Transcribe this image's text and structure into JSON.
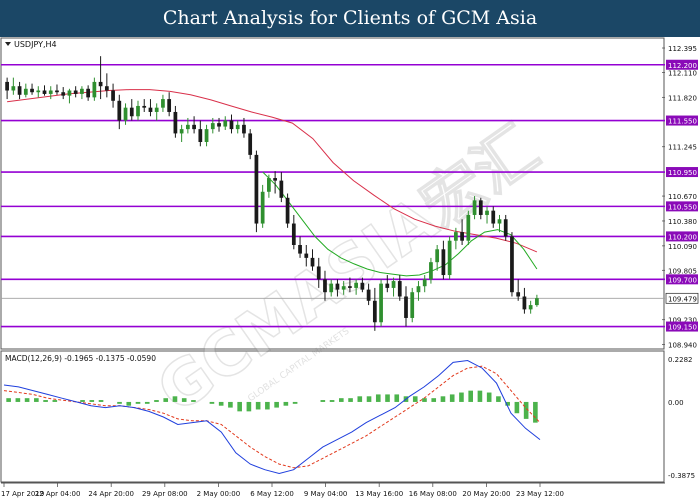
{
  "banner": {
    "title": "Chart Analysis for Clients of GCM Asia"
  },
  "watermark": {
    "text": "GCMASIA宏汇",
    "subtext": "GLOBAL CAPITAL MARKETS"
  },
  "colors": {
    "banner_bg": "#1b4766",
    "level_line": "#9400d3",
    "level_label_bg": "#8a0ab8",
    "bull_candle": "#2f8f2f",
    "bear_candle": "#1a1a1a",
    "ma_slow": "#d9304a",
    "ma_fast": "#22aa22",
    "macd_line": "#1f3fdd",
    "signal_line": "#e23a1e",
    "histogram": "#4cb34c",
    "current_price_line": "#a0a0a0"
  },
  "chart_data": [
    {
      "type": "candlestick",
      "title": "USDJPY,H4",
      "symbol_dropdown_icon": "triangle-down-icon",
      "x_tick_labels": [
        "17 Apr 2019",
        "22 Apr 04:00",
        "24 Apr 20:00",
        "29 Apr 08:00",
        "2 May 00:00",
        "6 May 12:00",
        "9 May 04:00",
        "13 May 16:00",
        "16 May 08:00",
        "20 May 20:00",
        "23 May 12:00"
      ],
      "y_tick_labels": [
        "112.395",
        "112.110",
        "111.820",
        "111.245",
        "110.670",
        "110.380",
        "110.090",
        "109.805",
        "109.230",
        "108.940"
      ],
      "ylim": [
        108.9,
        112.5
      ],
      "current_price": 109.479,
      "current_price_label": "109.479",
      "levels": [
        {
          "value": 112.2,
          "label": "112.200"
        },
        {
          "value": 111.55,
          "label": "111.550"
        },
        {
          "value": 110.95,
          "label": "110.950"
        },
        {
          "value": 110.55,
          "label": "110.550"
        },
        {
          "value": 110.2,
          "label": "110.200"
        },
        {
          "value": 109.7,
          "label": "109.700"
        },
        {
          "value": 109.15,
          "label": "109.150"
        }
      ],
      "candles": [
        [
          112.0,
          112.05,
          111.8,
          111.9
        ],
        [
          111.9,
          112.05,
          111.85,
          111.95
        ],
        [
          111.95,
          112.0,
          111.8,
          111.85
        ],
        [
          111.85,
          111.98,
          111.82,
          111.92
        ],
        [
          111.92,
          111.98,
          111.85,
          111.88
        ],
        [
          111.88,
          111.95,
          111.82,
          111.9
        ],
        [
          111.9,
          111.96,
          111.84,
          111.86
        ],
        [
          111.86,
          111.95,
          111.8,
          111.9
        ],
        [
          111.9,
          111.97,
          111.85,
          111.88
        ],
        [
          111.88,
          111.94,
          111.8,
          111.84
        ],
        [
          111.84,
          111.92,
          111.75,
          111.9
        ],
        [
          111.9,
          111.95,
          111.82,
          111.86
        ],
        [
          111.86,
          111.95,
          111.8,
          111.92
        ],
        [
          111.92,
          111.96,
          111.78,
          111.82
        ],
        [
          111.82,
          112.05,
          111.78,
          112.0
        ],
        [
          112.0,
          112.3,
          111.8,
          111.95
        ],
        [
          111.95,
          112.1,
          111.82,
          111.9
        ],
        [
          111.9,
          111.98,
          111.7,
          111.78
        ],
        [
          111.78,
          111.85,
          111.45,
          111.55
        ],
        [
          111.55,
          111.75,
          111.5,
          111.7
        ],
        [
          111.7,
          111.8,
          111.55,
          111.6
        ],
        [
          111.6,
          111.78,
          111.55,
          111.72
        ],
        [
          111.72,
          111.8,
          111.65,
          111.7
        ],
        [
          111.7,
          111.8,
          111.6,
          111.65
        ],
        [
          111.65,
          111.75,
          111.55,
          111.7
        ],
        [
          111.7,
          111.85,
          111.65,
          111.8
        ],
        [
          111.8,
          111.88,
          111.6,
          111.65
        ],
        [
          111.65,
          111.72,
          111.35,
          111.4
        ],
        [
          111.4,
          111.5,
          111.3,
          111.45
        ],
        [
          111.45,
          111.58,
          111.4,
          111.5
        ],
        [
          111.5,
          111.6,
          111.4,
          111.45
        ],
        [
          111.45,
          111.55,
          111.25,
          111.3
        ],
        [
          111.3,
          111.5,
          111.25,
          111.45
        ],
        [
          111.45,
          111.58,
          111.4,
          111.52
        ],
        [
          111.52,
          111.58,
          111.42,
          111.48
        ],
        [
          111.48,
          111.6,
          111.44,
          111.55
        ],
        [
          111.55,
          111.62,
          111.4,
          111.45
        ],
        [
          111.45,
          111.55,
          111.4,
          111.5
        ],
        [
          111.5,
          111.58,
          111.35,
          111.4
        ],
        [
          111.4,
          111.45,
          111.1,
          111.15
        ],
        [
          111.15,
          111.2,
          110.25,
          110.35
        ],
        [
          110.35,
          110.8,
          110.3,
          110.72
        ],
        [
          110.72,
          110.92,
          110.65,
          110.88
        ],
        [
          110.88,
          110.96,
          110.7,
          110.85
        ],
        [
          110.85,
          110.95,
          110.6,
          110.65
        ],
        [
          110.65,
          110.7,
          110.3,
          110.35
        ],
        [
          110.35,
          110.45,
          110.05,
          110.1
        ],
        [
          110.1,
          110.2,
          109.95,
          110.0
        ],
        [
          110.0,
          110.1,
          109.85,
          109.95
        ],
        [
          109.95,
          110.05,
          109.8,
          109.85
        ],
        [
          109.85,
          109.95,
          109.6,
          109.7
        ],
        [
          109.7,
          109.8,
          109.45,
          109.55
        ],
        [
          109.55,
          109.7,
          109.5,
          109.65
        ],
        [
          109.65,
          109.7,
          109.5,
          109.58
        ],
        [
          109.58,
          109.68,
          109.52,
          109.62
        ],
        [
          109.62,
          109.72,
          109.55,
          109.6
        ],
        [
          109.6,
          109.7,
          109.52,
          109.66
        ],
        [
          109.66,
          109.72,
          109.55,
          109.58
        ],
        [
          109.58,
          109.65,
          109.4,
          109.45
        ],
        [
          109.45,
          109.6,
          109.1,
          109.2
        ],
        [
          109.2,
          109.7,
          109.15,
          109.65
        ],
        [
          109.65,
          109.75,
          109.55,
          109.6
        ],
        [
          109.6,
          109.72,
          109.5,
          109.68
        ],
        [
          109.68,
          109.75,
          109.45,
          109.5
        ],
        [
          109.5,
          109.62,
          109.15,
          109.25
        ],
        [
          109.25,
          109.6,
          109.2,
          109.55
        ],
        [
          109.55,
          109.68,
          109.45,
          109.62
        ],
        [
          109.62,
          109.75,
          109.55,
          109.7
        ],
        [
          109.7,
          109.95,
          109.65,
          109.9
        ],
        [
          109.9,
          110.1,
          109.8,
          110.05
        ],
        [
          110.05,
          110.15,
          109.7,
          109.75
        ],
        [
          109.75,
          110.2,
          109.7,
          110.15
        ],
        [
          110.15,
          110.3,
          110.05,
          110.25
        ],
        [
          110.25,
          110.4,
          110.1,
          110.15
        ],
        [
          110.15,
          110.5,
          110.1,
          110.45
        ],
        [
          110.45,
          110.67,
          110.4,
          110.62
        ],
        [
          110.62,
          110.65,
          110.4,
          110.45
        ],
        [
          110.45,
          110.55,
          110.35,
          110.5
        ],
        [
          110.5,
          110.55,
          110.3,
          110.35
        ],
        [
          110.35,
          110.45,
          110.25,
          110.4
        ],
        [
          110.4,
          110.45,
          110.15,
          110.2
        ],
        [
          110.2,
          110.25,
          109.5,
          109.55
        ],
        [
          109.55,
          109.7,
          109.45,
          109.5
        ],
        [
          109.5,
          109.6,
          109.3,
          109.35
        ],
        [
          109.35,
          109.45,
          109.3,
          109.4
        ],
        [
          109.4,
          109.52,
          109.38,
          109.48
        ]
      ],
      "ma_slow": [
        111.77,
        111.8,
        111.83,
        111.86,
        111.88,
        111.9,
        111.91,
        111.91,
        111.89,
        111.85,
        111.79,
        111.72,
        111.65,
        111.59,
        111.52,
        111.34,
        111.06,
        110.85,
        110.68,
        110.52,
        110.4,
        110.32,
        110.26,
        110.22,
        110.18,
        110.12,
        110.02
      ],
      "ma_fast": [
        110.95,
        110.8,
        110.6,
        110.4,
        110.2,
        110.05,
        109.95,
        109.88,
        109.82,
        109.78,
        109.76,
        109.74,
        109.75,
        109.8,
        109.87,
        110.0,
        110.15,
        110.25,
        110.28,
        110.22,
        110.05,
        109.82
      ]
    },
    {
      "type": "macd",
      "title": "MACD(12,26,9) -0.1965 -0.1375 -0.0590",
      "y_tick_labels": [
        "0.2282",
        "0.00",
        "-0.3875"
      ],
      "ylim": [
        -0.42,
        0.26
      ],
      "macd_line": [
        0.09,
        0.08,
        0.06,
        0.04,
        0.02,
        0.0,
        -0.02,
        -0.03,
        -0.02,
        -0.03,
        -0.05,
        -0.08,
        -0.12,
        -0.11,
        -0.1,
        -0.16,
        -0.27,
        -0.33,
        -0.36,
        -0.38,
        -0.36,
        -0.3,
        -0.24,
        -0.2,
        -0.16,
        -0.11,
        -0.07,
        -0.03,
        0.03,
        0.08,
        0.14,
        0.21,
        0.22,
        0.18,
        0.1,
        -0.06,
        -0.14,
        -0.2
      ],
      "signal_line": [
        0.06,
        0.05,
        0.04,
        0.02,
        0.01,
        0.0,
        -0.01,
        -0.02,
        -0.02,
        -0.03,
        -0.04,
        -0.06,
        -0.09,
        -0.1,
        -0.1,
        -0.12,
        -0.18,
        -0.24,
        -0.29,
        -0.33,
        -0.35,
        -0.34,
        -0.3,
        -0.26,
        -0.22,
        -0.18,
        -0.13,
        -0.08,
        -0.03,
        0.02,
        0.08,
        0.14,
        0.18,
        0.19,
        0.15,
        0.06,
        -0.03,
        -0.11
      ],
      "histogram": [
        0.02,
        0.02,
        0.02,
        0.02,
        0.01,
        0.01,
        0.0,
        0.0,
        0.01,
        0.01,
        0.01,
        0.0,
        -0.01,
        -0.02,
        -0.01,
        -0.01,
        0.01,
        0.02,
        0.03,
        0.02,
        0.01,
        0.0,
        -0.01,
        -0.02,
        -0.03,
        -0.05,
        -0.05,
        -0.04,
        -0.04,
        -0.03,
        -0.02,
        -0.01,
        0.0,
        0.0,
        0.01,
        0.01,
        0.02,
        0.02,
        0.03,
        0.03,
        0.04,
        0.04,
        0.04,
        0.03,
        0.03,
        0.02,
        0.02,
        0.03,
        0.04,
        0.05,
        0.06,
        0.06,
        0.05,
        0.03,
        -0.02,
        -0.06,
        -0.09,
        -0.11
      ]
    }
  ]
}
